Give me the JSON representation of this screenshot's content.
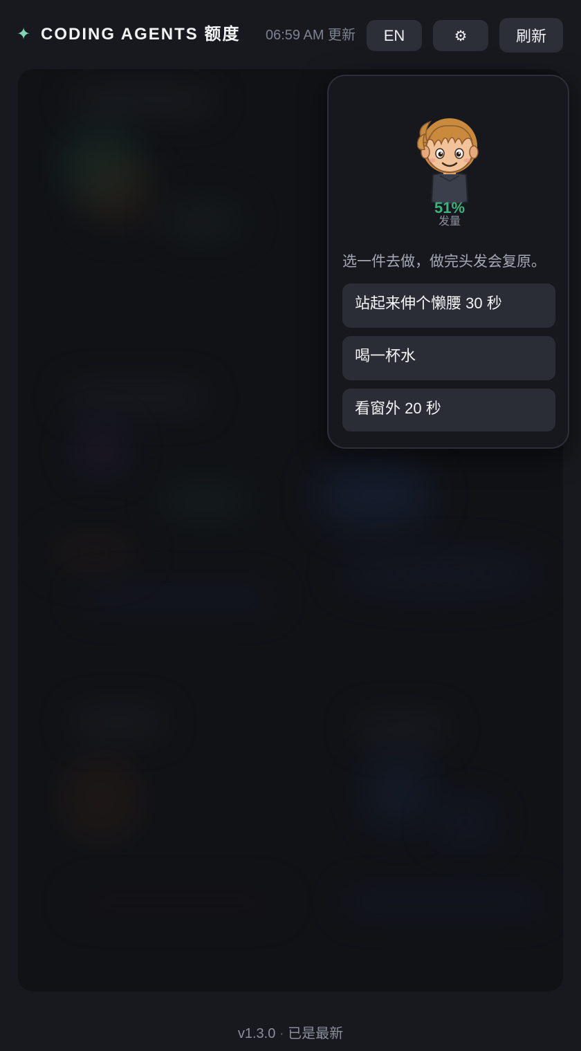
{
  "header": {
    "brand_icon": "sparkle-icon",
    "brand_symbol": "✦",
    "title": "CODING AGENTS 额度",
    "updated": "06:59 AM 更新",
    "lang_button": "EN",
    "settings_icon": "gear-icon",
    "settings_symbol": "⚙",
    "refresh_button": "刷新"
  },
  "break_popover": {
    "avatar_icon": "cartoon-avatar-icon",
    "hair_percent": "51%",
    "hair_level": 0.51,
    "hair_label": "发量",
    "prompt": "选一件去做，做完头发会复原。",
    "tasks": [
      {
        "label": "站起来伸个懒腰 30 秒"
      },
      {
        "label": "喝一杯水"
      },
      {
        "label": "看窗外 20 秒"
      }
    ]
  },
  "footer": {
    "version": "v1.3.0",
    "separator": "·",
    "status": "已是最新"
  },
  "colors": {
    "background": "#17191e",
    "accent_green": "#3cb37f",
    "button_bg": "#2c2f38"
  }
}
